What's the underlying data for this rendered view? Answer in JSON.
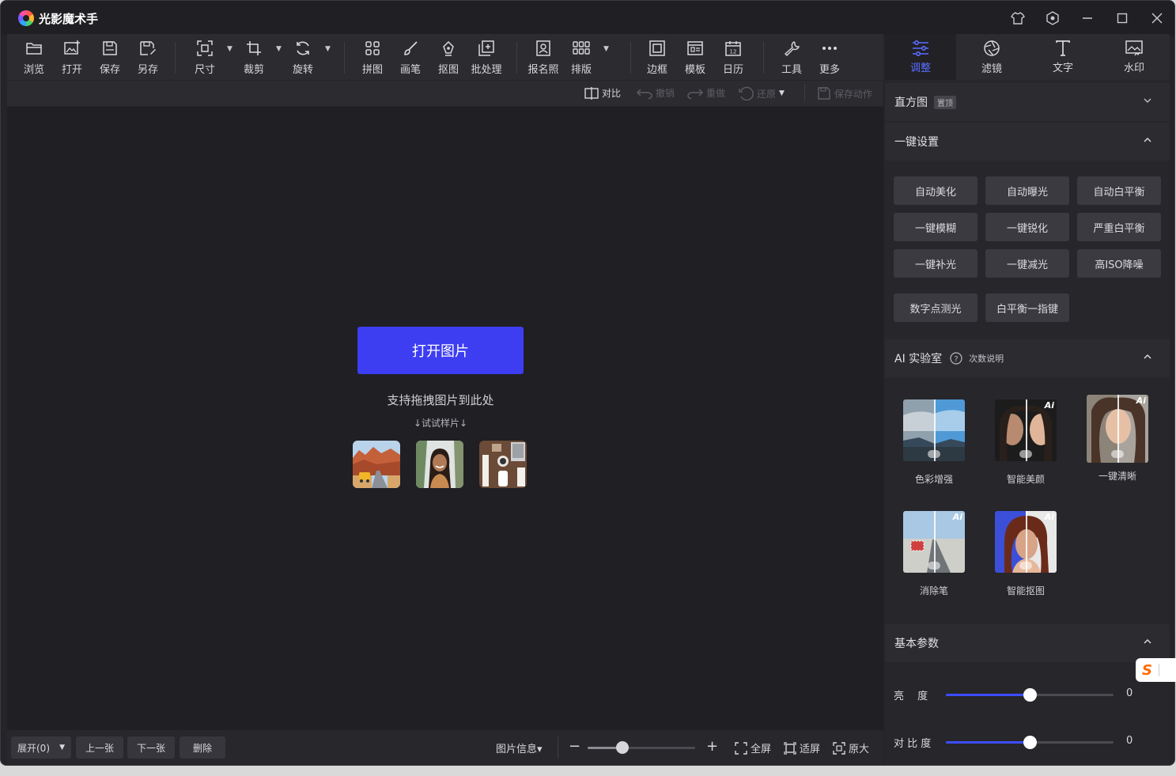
{
  "app": {
    "title": "光影魔术手"
  },
  "title_controls": [
    "shirt-icon",
    "settings-icon",
    "minimize-icon",
    "maximize-icon",
    "close-icon"
  ],
  "toolbar": {
    "browse": "浏览",
    "open": "打开",
    "save": "保存",
    "save_as": "另存",
    "size": "尺寸",
    "crop": "裁剪",
    "rotate": "旋转",
    "collage": "拼图",
    "brush": "画笔",
    "cutout": "抠图",
    "batch": "批处理",
    "id_photo": "报名照",
    "layout": "排版",
    "border": "边框",
    "template": "模板",
    "calendar": "日历",
    "tools": "工具",
    "more": "更多"
  },
  "subbar": {
    "compare": "对比",
    "undo": "撤销",
    "redo": "重做",
    "restore": "还原",
    "save_action": "保存动作"
  },
  "canvas": {
    "open_button": "打开图片",
    "drag_tip": "支持拖拽图片到此处",
    "sample_tip": "↓试试样片↓"
  },
  "bottom": {
    "expand": "展开(0)",
    "prev": "上一张",
    "next": "下一张",
    "delete": "删除",
    "image_info": "图片信息▾",
    "zoom_level": 0.32,
    "fullscreen": "全屏",
    "fit": "适屏",
    "original": "原大"
  },
  "right_tabs": {
    "adjust": "调整",
    "filter": "滤镜",
    "text": "文字",
    "watermark": "水印"
  },
  "colors": {
    "accent": "#3d3df2",
    "active_tab": "#5a6cff"
  },
  "panel": {
    "histogram": {
      "title": "直方图",
      "pin": "置顶"
    },
    "one_click": {
      "title": "一键设置",
      "buttons": [
        "自动美化",
        "自动曝光",
        "自动白平衡",
        "一键模糊",
        "一键锐化",
        "严重白平衡",
        "一键补光",
        "一键减光",
        "高ISO降噪",
        "数字点测光",
        "白平衡一指键"
      ]
    },
    "ai_lab": {
      "title": "AI 实验室",
      "help": "次数说明",
      "badge": "Ai",
      "items": [
        "色彩增强",
        "智能美颜",
        "一键清晰",
        "消除笔",
        "智能抠图"
      ]
    },
    "basic": {
      "title": "基本参数",
      "brightness_label": "亮　 度",
      "brightness_value": "0",
      "brightness_level": 0.5,
      "contrast_label": "对 比 度",
      "contrast_value": "0",
      "contrast_level": 0.5
    }
  }
}
